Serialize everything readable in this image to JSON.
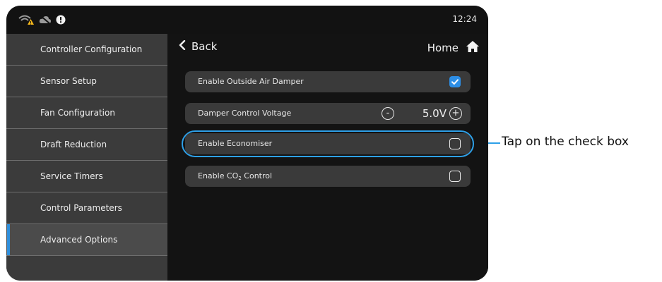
{
  "status_bar": {
    "time": "12:24",
    "notification_count": "1"
  },
  "sidebar": {
    "items": [
      {
        "label": "Controller Configuration",
        "active": false
      },
      {
        "label": "Sensor Setup",
        "active": false
      },
      {
        "label": "Fan Configuration",
        "active": false
      },
      {
        "label": "Draft Reduction",
        "active": false
      },
      {
        "label": "Service Timers",
        "active": false
      },
      {
        "label": "Control Parameters",
        "active": false
      },
      {
        "label": "Advanced Options",
        "active": true
      }
    ]
  },
  "nav": {
    "back_label": "Back",
    "home_label": "Home"
  },
  "settings": {
    "outside_air_damper": {
      "label": "Enable Outside Air Damper",
      "checked": true
    },
    "damper_voltage": {
      "label": "Damper Control Voltage",
      "value": "5.0V",
      "minus": "-",
      "plus": "+"
    },
    "economiser": {
      "label": "Enable Economiser",
      "checked": false
    },
    "co2_control": {
      "label_prefix": "Enable CO",
      "label_sub": "2",
      "label_suffix": " Control",
      "checked": false
    }
  },
  "callout": {
    "text": "Tap on the check box"
  },
  "colors": {
    "accent": "#2c8ee6",
    "highlight": "#2ea0e8",
    "sidebar_bg": "#3b3b3b",
    "screen_bg": "#131313",
    "row_bg": "#3a3a3a"
  },
  "icons": [
    "wifi-warning-icon",
    "cloud-off-icon",
    "notification-badge-icon",
    "chevron-left-icon",
    "home-icon",
    "checkmark-icon"
  ]
}
